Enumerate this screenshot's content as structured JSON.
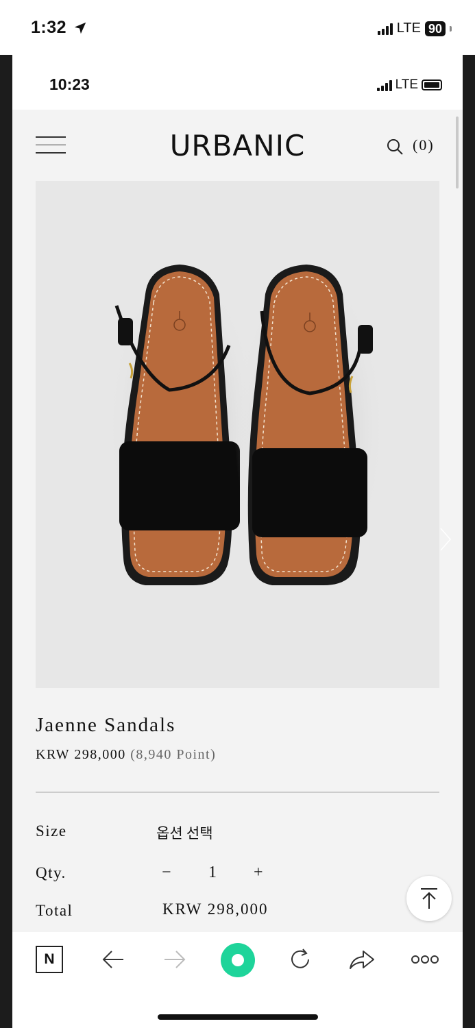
{
  "outer_status": {
    "time": "1:32",
    "network": "LTE",
    "battery": "90"
  },
  "inner_status": {
    "time": "10:23",
    "network": "LTE"
  },
  "header": {
    "logo": "URBANIC",
    "cart_count": "(0)"
  },
  "product": {
    "name": "Jaenne Sandals",
    "price": "KRW 298,000",
    "points": "(8,940 Point)"
  },
  "options": {
    "size_label": "Size",
    "size_value": "옵션 선택",
    "qty_label": "Qty.",
    "qty_minus": "−",
    "qty_value": "1",
    "qty_plus": "+",
    "total_label": "Total",
    "total_value": "KRW 298,000"
  },
  "toolbar": {
    "naver_label": "N"
  },
  "icons": [
    "location-arrow-icon",
    "menu-icon",
    "search-icon",
    "chevron-right-icon",
    "scroll-to-top-icon",
    "back-icon",
    "forward-icon",
    "green-home-icon",
    "refresh-icon",
    "share-icon",
    "more-icon"
  ]
}
